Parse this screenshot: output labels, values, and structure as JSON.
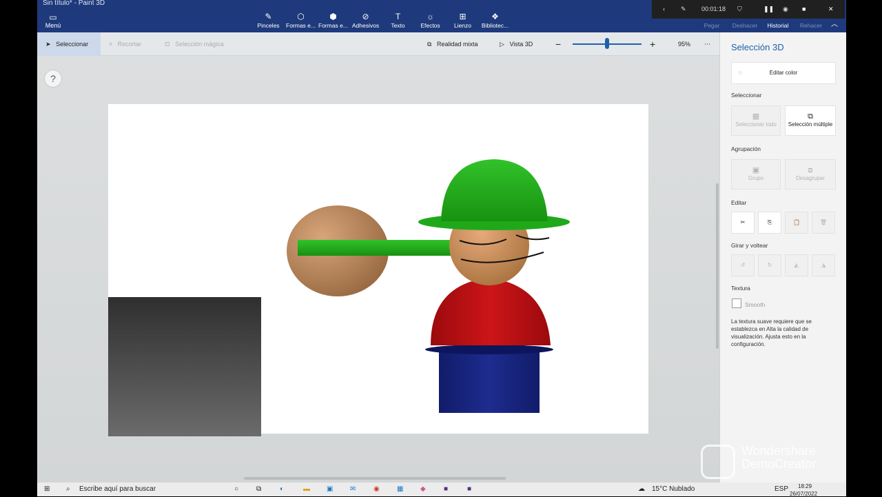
{
  "window": {
    "title": "Sin título* - Paint 3D"
  },
  "ribbon": {
    "menu_label": "Menú",
    "tools": [
      {
        "label": "Pinceles",
        "icon": "brush-icon",
        "glyph": "✎"
      },
      {
        "label": "Formas e...",
        "icon": "shapes-2d-icon",
        "glyph": "⬡"
      },
      {
        "label": "Formas e...",
        "icon": "shapes-3d-icon",
        "glyph": "⬢"
      },
      {
        "label": "Adhesivos",
        "icon": "sticker-icon",
        "glyph": "⊘"
      },
      {
        "label": "Texto",
        "icon": "text-icon",
        "glyph": "T"
      },
      {
        "label": "Efectos",
        "icon": "effects-icon",
        "glyph": "☼"
      },
      {
        "label": "Lienzo",
        "icon": "canvas-icon",
        "glyph": "⊞"
      },
      {
        "label": "Bibliotec...",
        "icon": "library-icon",
        "glyph": "❖"
      }
    ],
    "right": [
      {
        "label": "Pegar"
      },
      {
        "label": "Deshacer"
      },
      {
        "label": "Historial"
      },
      {
        "label": "Rehacer"
      }
    ]
  },
  "recorder": {
    "time": "00:01:18"
  },
  "toolbar": {
    "select": "Seleccionar",
    "crop": "Recortar",
    "magic": "Selección mágica",
    "mixed_reality": "Realidad mixta",
    "view3d": "Vista 3D",
    "zoom": "95%",
    "zoom_level": 0.5
  },
  "panel": {
    "title": "Selección 3D",
    "edit_color": "Editar color",
    "select_label": "Seleccionar",
    "select_all": "Seleccionar todo",
    "multi_select": "Selección múltiple",
    "group_label": "Agrupación",
    "group": "Grupo",
    "ungroup": "Desagrupar",
    "edit_label": "Editar",
    "rotate_label": "Girar y voltear",
    "texture_label": "Textura",
    "smooth": "Smooth",
    "note": "La textura suave requiere que se establezca en Alta la calidad de visualización. Ajusta esto en la configuración."
  },
  "taskbar": {
    "search": "Escribe aquí para buscar",
    "weather": "15°C  Nublado",
    "lang": "ESP",
    "time": "18:29",
    "date": "26/07/2022"
  },
  "watermark": {
    "line1": "Wondershare",
    "line2": "DemoCreator"
  }
}
